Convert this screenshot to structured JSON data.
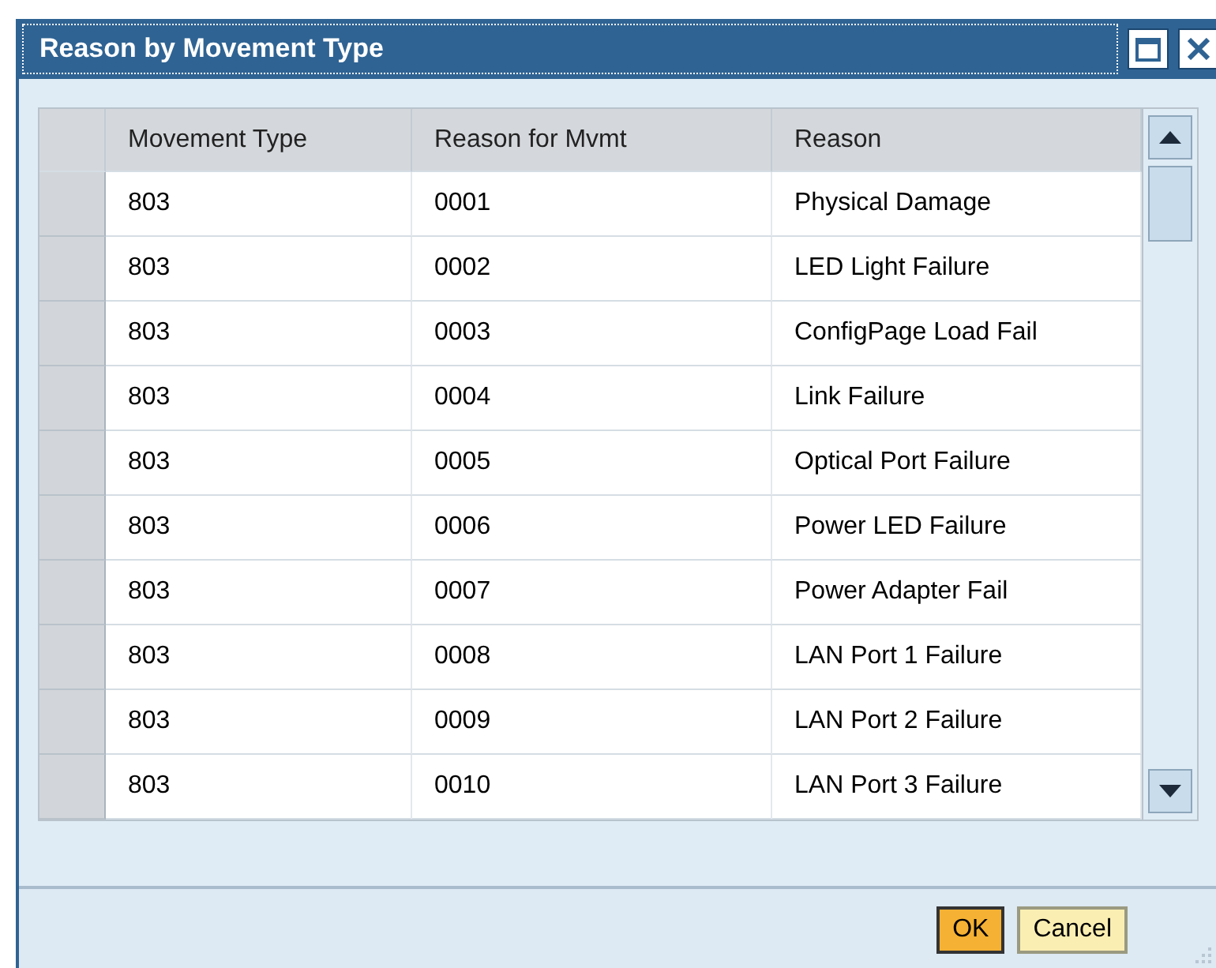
{
  "window": {
    "title": "Reason by Movement Type"
  },
  "table": {
    "columns": [
      "Movement Type",
      "Reason for Mvmt",
      "Reason"
    ],
    "rows": [
      [
        "803",
        "0001",
        "Physical Damage"
      ],
      [
        "803",
        "0002",
        "LED Light Failure"
      ],
      [
        "803",
        "0003",
        "ConfigPage Load Fail"
      ],
      [
        "803",
        "0004",
        "Link Failure"
      ],
      [
        "803",
        "0005",
        "Optical Port Failure"
      ],
      [
        "803",
        "0006",
        "Power LED Failure"
      ],
      [
        "803",
        "0007",
        "Power Adapter Fail"
      ],
      [
        "803",
        "0008",
        "LAN Port 1 Failure"
      ],
      [
        "803",
        "0009",
        "LAN Port 2 Failure"
      ],
      [
        "803",
        "0010",
        "LAN Port 3 Failure"
      ]
    ]
  },
  "buttons": [
    {
      "label": "OK",
      "kind": "primary"
    },
    {
      "label": "Cancel",
      "kind": "secondary"
    }
  ]
}
